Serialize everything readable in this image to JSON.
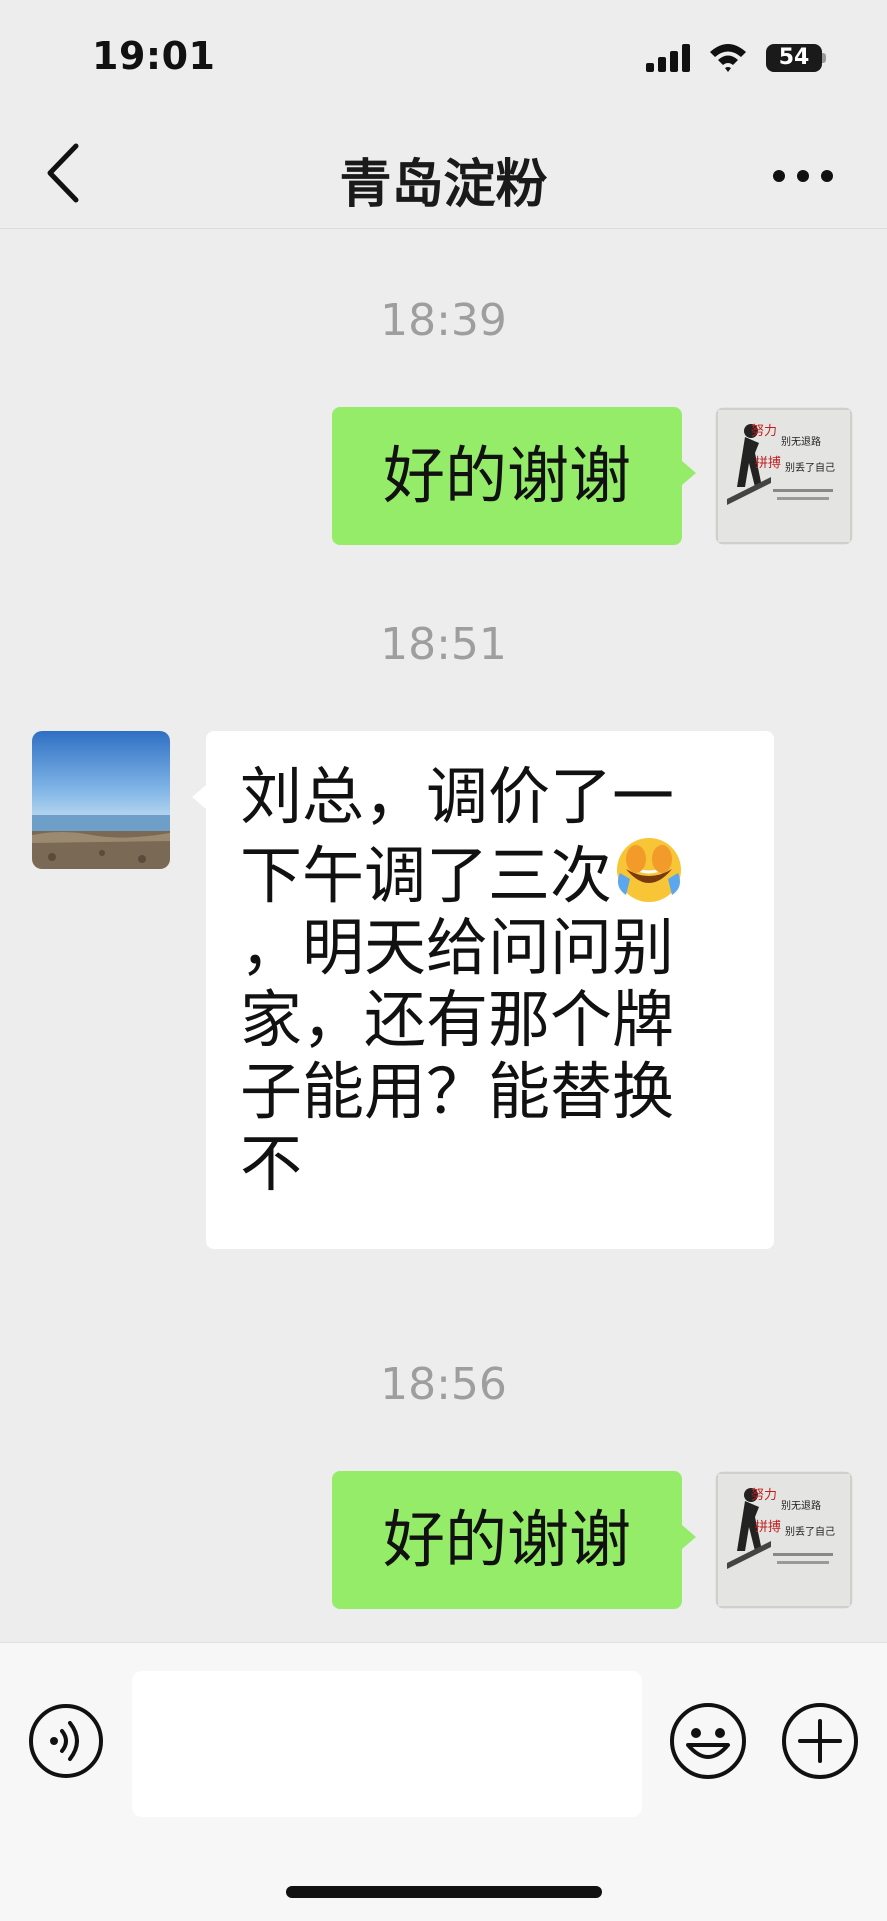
{
  "status_bar": {
    "time": "19:01",
    "battery": "54"
  },
  "header": {
    "title": "青岛淀粉"
  },
  "messages": [
    {
      "time": "18:39",
      "sender": "me",
      "text": "好的谢谢"
    },
    {
      "time": "18:51",
      "sender": "contact",
      "lines": [
        "刘总，调价了一",
        "下午调了三次",
        "，明天给问问别",
        "家，还有那个牌",
        "子能用？能替换",
        "不"
      ]
    },
    {
      "time": "18:56",
      "sender": "me",
      "text": "好的谢谢"
    }
  ],
  "my_avatar": {
    "caption_1": "努力",
    "caption_2": "别无退路",
    "caption_3": "拼搏",
    "caption_4": "别丢了自己"
  },
  "input": {
    "placeholder": ""
  },
  "colors": {
    "background": "#ededed",
    "sent_bubble": "#95ec69",
    "received_bubble": "#ffffff",
    "timestamp": "#9e9e9e"
  },
  "icons": {
    "back": "chevron-left-icon",
    "more": "ellipsis-icon",
    "voice": "voice-icon",
    "emoji": "smiley-icon",
    "plus": "plus-icon",
    "laugh_cry": "facepalm-emoji"
  }
}
